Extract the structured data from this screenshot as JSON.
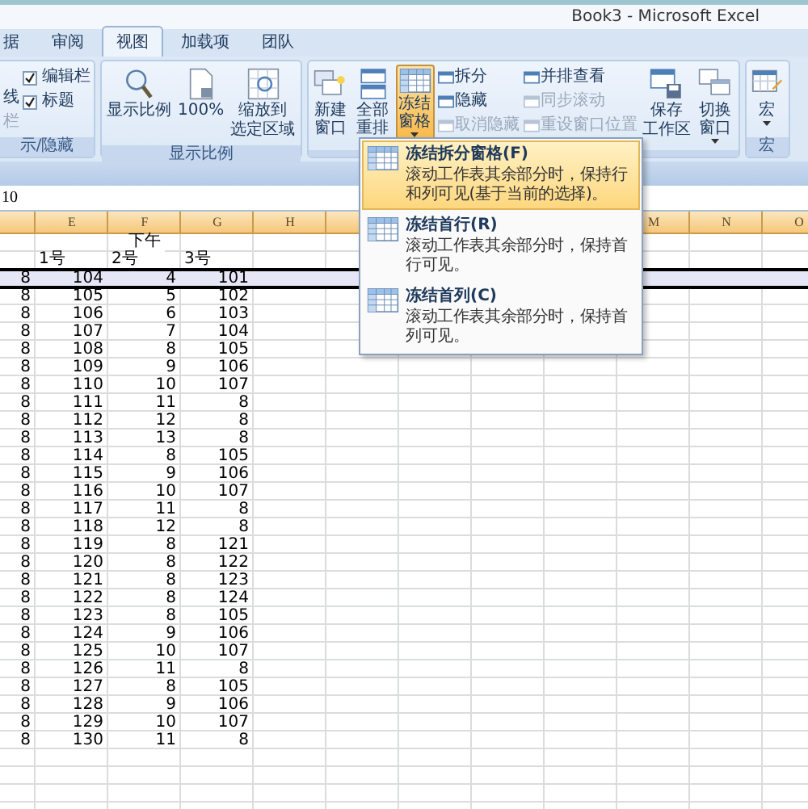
{
  "window": {
    "title": "Book3 - Microsoft Excel"
  },
  "tabs": [
    {
      "label": "据",
      "selected": false
    },
    {
      "label": "审阅",
      "selected": false
    },
    {
      "label": "视图",
      "selected": true
    },
    {
      "label": "加载项",
      "selected": false
    },
    {
      "label": "团队",
      "selected": false
    }
  ],
  "ribbon": {
    "show_hide": {
      "cut_labels": [
        {
          "text": "线",
          "disabled": false
        },
        {
          "text": "栏",
          "disabled": true
        }
      ],
      "checkboxes": [
        {
          "label": "编辑栏",
          "checked": true
        },
        {
          "label": "标题",
          "checked": true
        }
      ],
      "group_label": "示/隐藏"
    },
    "zoom": {
      "buttons": [
        {
          "label_lines": [
            "显示比例"
          ]
        },
        {
          "label_lines": [
            "100%"
          ]
        },
        {
          "label_lines": [
            "缩放到",
            "选定区域"
          ]
        }
      ],
      "group_label": "显示比例"
    },
    "window_group": {
      "large_buttons": [
        {
          "label": "新建窗口",
          "pressed": false,
          "dropdown": false
        },
        {
          "label": "全部重排",
          "pressed": false,
          "dropdown": false
        },
        {
          "label": "冻结窗格",
          "pressed": true,
          "dropdown": true
        }
      ],
      "small_buttons": [
        {
          "label": "拆分",
          "disabled": false
        },
        {
          "label": "隐藏",
          "disabled": false
        },
        {
          "label": "取消隐藏",
          "disabled": true
        },
        {
          "label": "并排查看",
          "disabled": false
        },
        {
          "label": "同步滚动",
          "disabled": true
        },
        {
          "label": "重设窗口位置",
          "disabled": true
        }
      ],
      "more_buttons": [
        {
          "label_lines": [
            "保存",
            "工作区"
          ],
          "dropdown": false
        },
        {
          "label_lines": [
            "切换窗口"
          ],
          "dropdown": true
        }
      ]
    },
    "macros": {
      "button": {
        "label": "宏",
        "dropdown": true
      },
      "group_label": "宏"
    }
  },
  "formula_bar": {
    "value": "10"
  },
  "freeze_menu": {
    "items": [
      {
        "title": "冻结拆分窗格(F)",
        "description": "滚动工作表其余部分时，保持行和列可见(基于当前的选择)。",
        "selected": true
      },
      {
        "title": "冻结首行(R)",
        "description": "滚动工作表其余部分时，保持首行可见。",
        "selected": false
      },
      {
        "title": "冻结首列(C)",
        "description": "滚动工作表其余部分时，保持首列可见。",
        "selected": false
      }
    ]
  },
  "sheet": {
    "columns": [
      {
        "kind": "cut"
      },
      {
        "kind": "letter",
        "letter": "E"
      },
      {
        "kind": "letter",
        "letter": "F"
      },
      {
        "kind": "letter",
        "letter": "G"
      },
      {
        "kind": "letter",
        "letter": "H"
      },
      {
        "kind": "covered"
      },
      {
        "kind": "covered"
      },
      {
        "kind": "covered"
      },
      {
        "kind": "covered"
      },
      {
        "kind": "letter",
        "letter": "M"
      },
      {
        "kind": "letter",
        "letter": "N"
      },
      {
        "kind": "letter",
        "letter": "O"
      }
    ],
    "merged_title": "下午",
    "subheaders": [
      "1号",
      "2号",
      "3号"
    ],
    "rows": [
      {
        "cells": [
          "8",
          "104",
          "4",
          "101"
        ],
        "selected": true
      },
      {
        "cells": [
          "8",
          "105",
          "5",
          "102"
        ],
        "selected": false
      },
      {
        "cells": [
          "8",
          "106",
          "6",
          "103"
        ],
        "selected": false
      },
      {
        "cells": [
          "8",
          "107",
          "7",
          "104"
        ],
        "selected": false
      },
      {
        "cells": [
          "8",
          "108",
          "8",
          "105"
        ],
        "selected": false
      },
      {
        "cells": [
          "8",
          "109",
          "9",
          "106"
        ],
        "selected": false
      },
      {
        "cells": [
          "8",
          "110",
          "10",
          "107"
        ],
        "selected": false
      },
      {
        "cells": [
          "8",
          "111",
          "11",
          "8"
        ],
        "selected": false
      },
      {
        "cells": [
          "8",
          "112",
          "12",
          "8"
        ],
        "selected": false
      },
      {
        "cells": [
          "8",
          "113",
          "13",
          "8"
        ],
        "selected": false
      },
      {
        "cells": [
          "8",
          "114",
          "8",
          "105"
        ],
        "selected": false
      },
      {
        "cells": [
          "8",
          "115",
          "9",
          "106"
        ],
        "selected": false
      },
      {
        "cells": [
          "8",
          "116",
          "10",
          "107"
        ],
        "selected": false
      },
      {
        "cells": [
          "8",
          "117",
          "11",
          "8"
        ],
        "selected": false
      },
      {
        "cells": [
          "8",
          "118",
          "12",
          "8"
        ],
        "selected": false
      },
      {
        "cells": [
          "8",
          "119",
          "8",
          "121"
        ],
        "selected": false
      },
      {
        "cells": [
          "8",
          "120",
          "8",
          "122"
        ],
        "selected": false
      },
      {
        "cells": [
          "8",
          "121",
          "8",
          "123"
        ],
        "selected": false
      },
      {
        "cells": [
          "8",
          "122",
          "8",
          "124"
        ],
        "selected": false
      },
      {
        "cells": [
          "8",
          "123",
          "8",
          "105"
        ],
        "selected": false
      },
      {
        "cells": [
          "8",
          "124",
          "9",
          "106"
        ],
        "selected": false
      },
      {
        "cells": [
          "8",
          "125",
          "10",
          "107"
        ],
        "selected": false
      },
      {
        "cells": [
          "8",
          "126",
          "11",
          "8"
        ],
        "selected": false
      },
      {
        "cells": [
          "8",
          "127",
          "8",
          "105"
        ],
        "selected": false
      },
      {
        "cells": [
          "8",
          "128",
          "9",
          "106"
        ],
        "selected": false
      },
      {
        "cells": [
          "8",
          "129",
          "10",
          "107"
        ],
        "selected": false
      },
      {
        "cells": [
          "8",
          "130",
          "11",
          "8"
        ],
        "selected": false
      }
    ]
  }
}
